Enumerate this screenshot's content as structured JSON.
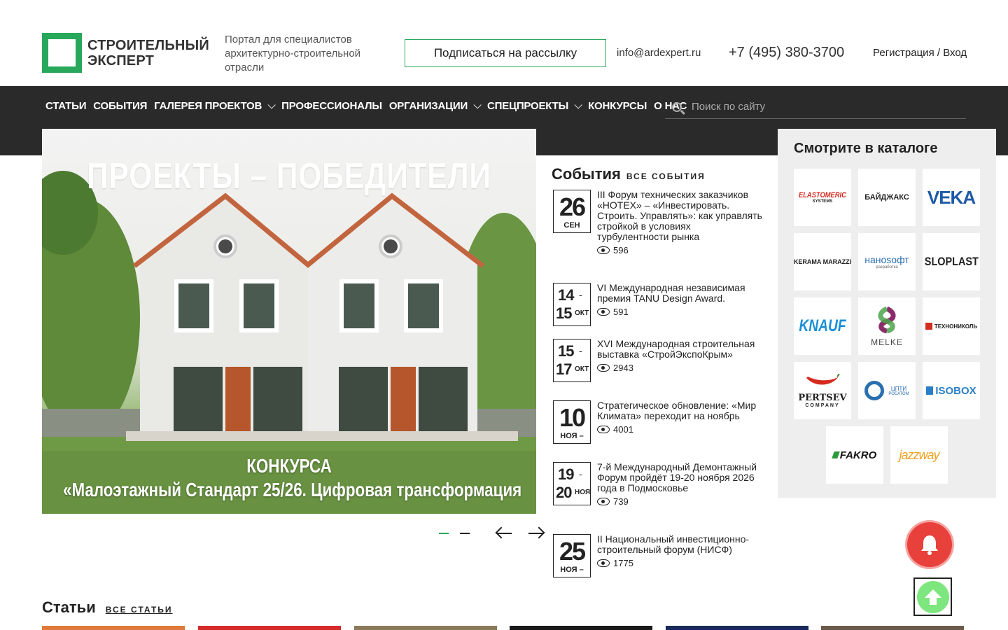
{
  "header": {
    "logo_line1": "СТРОИТЕЛЬНЫЙ",
    "logo_line2": "ЭКСПЕРТ",
    "tagline": "Портал для специалистов архитектурно-строительной отрасли",
    "subscribe_label": "Подписаться на рассылку",
    "email": "info@ardexpert.ru",
    "phone": "+7 (495) 380-3700",
    "auth_label": "Регистрация / Вход"
  },
  "nav": {
    "items": [
      {
        "label": "Статьи",
        "dropdown": false
      },
      {
        "label": "События",
        "dropdown": false
      },
      {
        "label": "Галерея проектов",
        "dropdown": true
      },
      {
        "label": "Профессионалы",
        "dropdown": false
      },
      {
        "label": "Организации",
        "dropdown": true
      },
      {
        "label": "Спецпроекты",
        "dropdown": true
      },
      {
        "label": "Конкурсы",
        "dropdown": false
      },
      {
        "label": "О нас",
        "dropdown": false
      }
    ],
    "search_placeholder": "Поиск по сайту"
  },
  "slider": {
    "title": "ПРОЕКТЫ – ПОБЕДИТЕЛИ",
    "sub1": "КОНКУРСА",
    "sub2": "«Малоэтажный Стандарт 25/26. Цифровая трансформация",
    "active_index": 0,
    "dot_count": 2
  },
  "events": {
    "title": "События",
    "all_label": "все события",
    "items": [
      {
        "day": "26",
        "month": "сен",
        "title": "III Форум технических заказчиков «НОТЕХ» – «Инвестировать. Строить. Управлять»: как управлять стройкой в условиях турбулентности рынка",
        "views": "596"
      },
      {
        "day": "14",
        "day2": "15",
        "month": "окт",
        "title": "VI Международная независимая премия TANU Design Award.",
        "views": "591"
      },
      {
        "day": "15",
        "day2": "17",
        "month": "окт",
        "title": "XVI Международная строительная выставка «СтройЭкспоКрым»",
        "views": "2943"
      },
      {
        "day": "10",
        "month": "ноя –",
        "title": "Стратегическое обновление: «Мир Климата» переходит на ноябрь",
        "views": "4001"
      },
      {
        "day": "19",
        "day2": "20",
        "month": "ноя",
        "title": "7-й Международный Демонтажный Форум пройдёт 19-20 ноября 2026 года в Подмосковье",
        "views": "739"
      },
      {
        "day": "25",
        "month": "ноя –",
        "title": "II Национальный инвестиционно-строительный форум (НИСФ)",
        "views": "1775"
      }
    ]
  },
  "catalog": {
    "title": "Смотрите в каталоге",
    "brands": [
      {
        "name": "ELASTOMERIC",
        "sub": "SYSTEMS",
        "color": "#d42a1f"
      },
      {
        "name": "БАЙДЖАКС",
        "color": "#222222"
      },
      {
        "name": "VEKA",
        "color": "#1d5aa8"
      },
      {
        "name": "KERAMA MARAZZI",
        "color": "#222222"
      },
      {
        "name": "наноsофт",
        "sub": "разработка",
        "color": "#2a6fb0"
      },
      {
        "name": "SLOPLAST",
        "color": "#222222"
      },
      {
        "name": "KNAUF",
        "color": "#1a8fd6"
      },
      {
        "name": "MELKE",
        "color": "#444444"
      },
      {
        "name": "ТЕХНОНИКОЛЬ",
        "color": "#222222"
      },
      {
        "name": "PERTSEV",
        "sub": "COMPANY",
        "color": "#222222"
      },
      {
        "name": "ЦПТИ",
        "sub": "РОСАТОМ",
        "color": "#2a6fb0"
      },
      {
        "name": "ISOBOX",
        "color": "#2a7fc9"
      },
      {
        "name": "FAKRO",
        "color": "#111111"
      },
      {
        "name": "jazzway",
        "color": "#f0a01e"
      }
    ]
  },
  "articles": {
    "title": "Статьи",
    "all_label": "все статьи"
  },
  "colors": {
    "accent": "#27a85a",
    "navbar": "#2a2a2a",
    "bell": "#e8403b",
    "up": "#7ee67e"
  }
}
